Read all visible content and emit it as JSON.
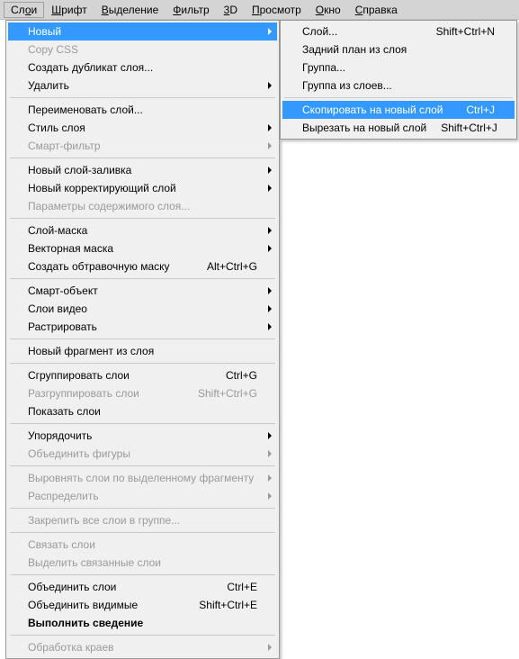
{
  "menubar": [
    {
      "label": "Слои",
      "underline": 2,
      "active": true
    },
    {
      "label": "Шрифт",
      "underline": 0
    },
    {
      "label": "Выделение",
      "underline": 0
    },
    {
      "label": "Фильтр",
      "underline": 0
    },
    {
      "label": "3D",
      "underline": 0
    },
    {
      "label": "Просмотр",
      "underline": 0
    },
    {
      "label": "Окно",
      "underline": 0
    },
    {
      "label": "Справка",
      "underline": 0
    }
  ],
  "main_menu": [
    {
      "label": "Новый",
      "submenu": true,
      "highlight": true
    },
    {
      "label": "Copy CSS",
      "disabled": true
    },
    {
      "label": "Создать дубликат слоя..."
    },
    {
      "label": "Удалить",
      "submenu": true
    },
    {
      "sep": true
    },
    {
      "label": "Переименовать слой..."
    },
    {
      "label": "Стиль слоя",
      "submenu": true
    },
    {
      "label": "Смарт-фильтр",
      "submenu": true,
      "disabled": true
    },
    {
      "sep": true
    },
    {
      "label": "Новый слой-заливка",
      "submenu": true
    },
    {
      "label": "Новый корректирующий слой",
      "submenu": true
    },
    {
      "label": "Параметры содержимого слоя...",
      "disabled": true
    },
    {
      "sep": true
    },
    {
      "label": "Слой-маска",
      "submenu": true
    },
    {
      "label": "Векторная маска",
      "submenu": true
    },
    {
      "label": "Создать обтравочную маску",
      "shortcut": "Alt+Ctrl+G"
    },
    {
      "sep": true
    },
    {
      "label": "Смарт-объект",
      "submenu": true
    },
    {
      "label": "Слои видео",
      "submenu": true
    },
    {
      "label": "Растрировать",
      "submenu": true
    },
    {
      "sep": true
    },
    {
      "label": "Новый фрагмент из слоя"
    },
    {
      "sep": true
    },
    {
      "label": "Сгруппировать слои",
      "shortcut": "Ctrl+G"
    },
    {
      "label": "Разгруппировать слои",
      "shortcut": "Shift+Ctrl+G",
      "disabled": true
    },
    {
      "label": "Показать слои"
    },
    {
      "sep": true
    },
    {
      "label": "Упорядочить",
      "submenu": true
    },
    {
      "label": "Объединить фигуры",
      "submenu": true,
      "disabled": true
    },
    {
      "sep": true
    },
    {
      "label": "Выровнять слои по выделенному фрагменту",
      "submenu": true,
      "disabled": true
    },
    {
      "label": "Распределить",
      "submenu": true,
      "disabled": true
    },
    {
      "sep": true
    },
    {
      "label": "Закрепить все слои в группе...",
      "disabled": true
    },
    {
      "sep": true
    },
    {
      "label": "Связать слои",
      "disabled": true
    },
    {
      "label": "Выделить связанные слои",
      "disabled": true
    },
    {
      "sep": true
    },
    {
      "label": "Объединить слои",
      "shortcut": "Ctrl+E"
    },
    {
      "label": "Объединить видимые",
      "shortcut": "Shift+Ctrl+E"
    },
    {
      "label": "Выполнить сведение",
      "bold": true
    },
    {
      "sep": true
    },
    {
      "label": "Обработка краев",
      "submenu": true,
      "disabled": true
    }
  ],
  "sub_menu": [
    {
      "label": "Слой...",
      "shortcut": "Shift+Ctrl+N"
    },
    {
      "label": "Задний план из слоя"
    },
    {
      "label": "Группа..."
    },
    {
      "label": "Группа из слоев..."
    },
    {
      "sep": true
    },
    {
      "label": "Скопировать на новый слой",
      "shortcut": "Ctrl+J",
      "highlight": true
    },
    {
      "label": "Вырезать на новый слой",
      "shortcut": "Shift+Ctrl+J"
    }
  ]
}
